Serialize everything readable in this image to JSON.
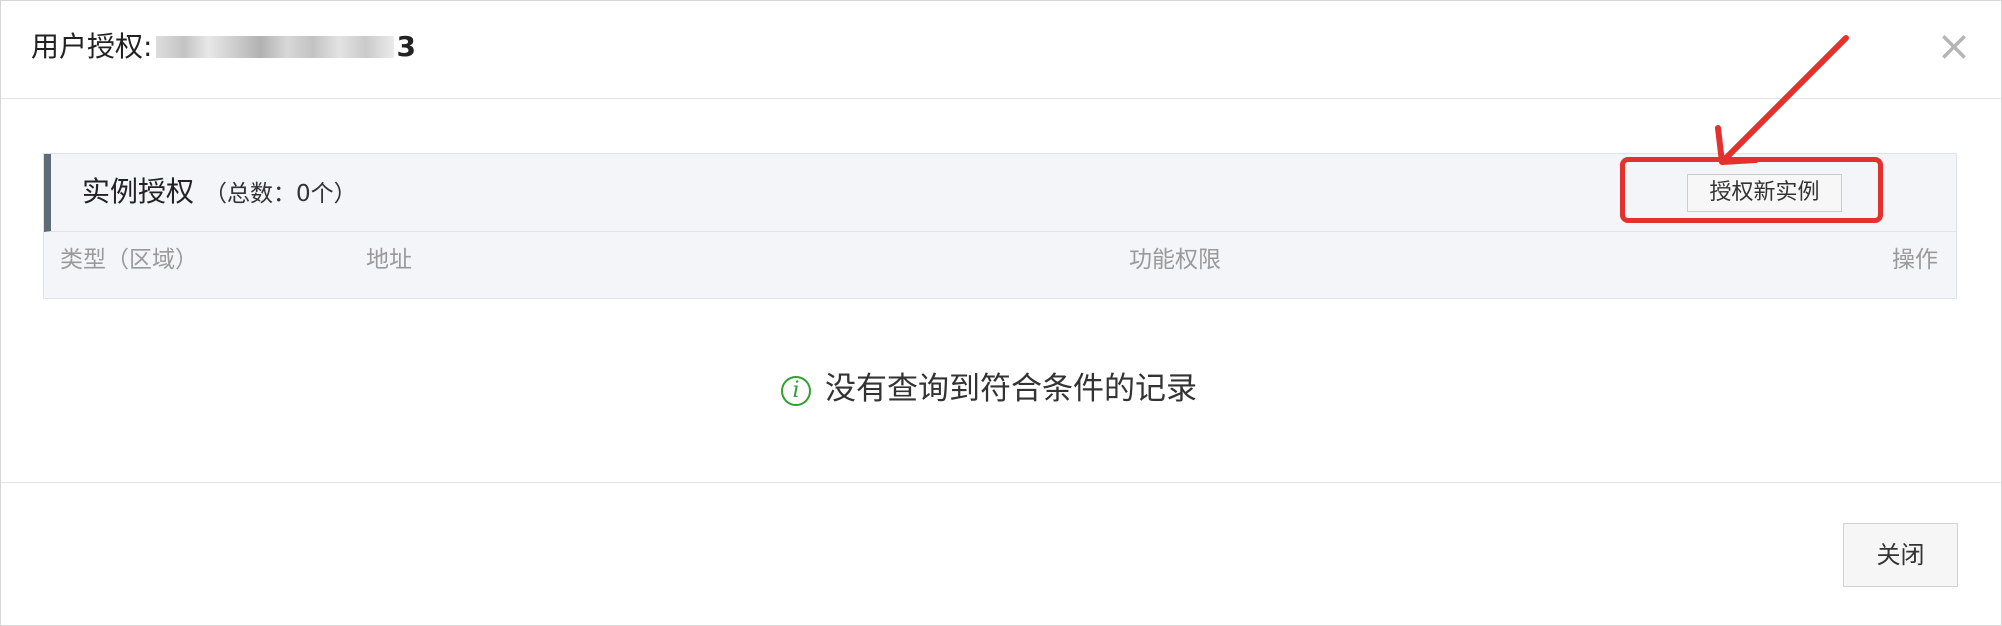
{
  "dialog": {
    "title_label": "用户授权:",
    "title_suffix": "3",
    "close_symbol": "×"
  },
  "panel": {
    "title": "实例授权",
    "count": "（总数：0个）",
    "authorize_button": "授权新实例",
    "columns": [
      "类型（区域）",
      "地址",
      "功能权限",
      "操作"
    ]
  },
  "empty_state": {
    "icon": "info-circle-icon",
    "icon_glyph": "i",
    "message": "没有查询到符合条件的记录"
  },
  "footer": {
    "close_button": "关闭"
  },
  "annotation": {
    "highlight_color": "#e5312d"
  }
}
